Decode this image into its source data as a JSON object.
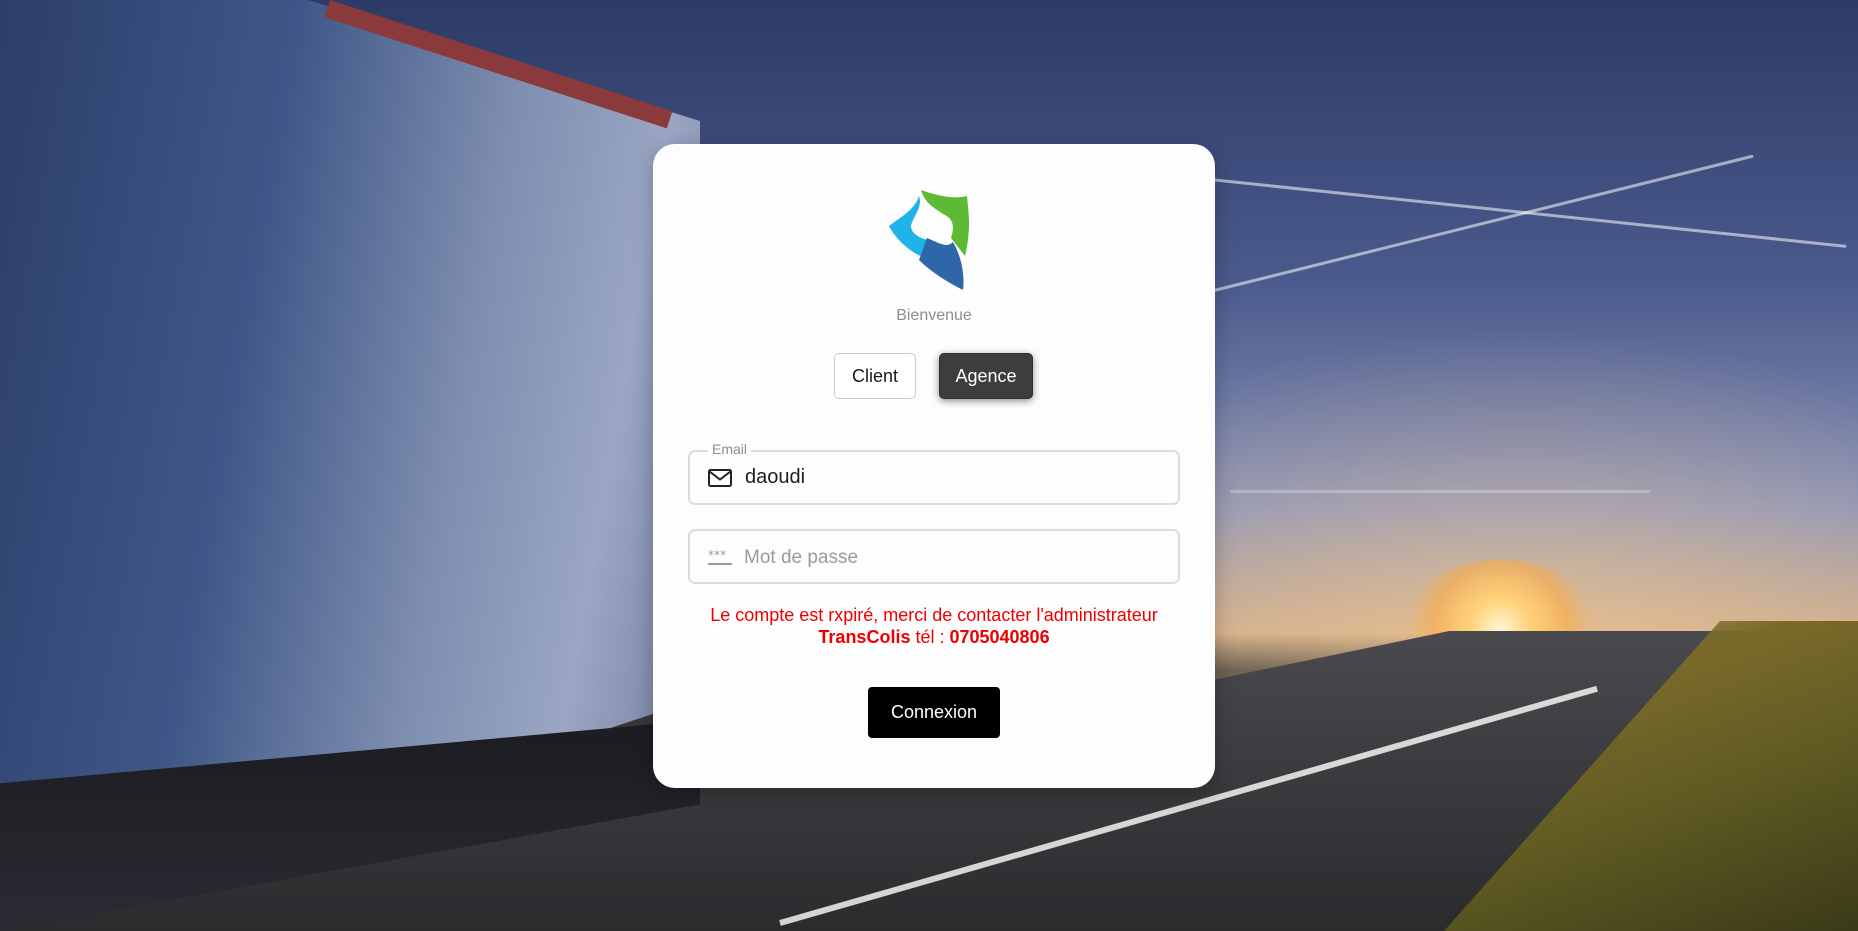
{
  "login": {
    "welcome": "Bienvenue",
    "tabs": {
      "client": "Client",
      "agence": "Agence",
      "selected": "Agence"
    },
    "email": {
      "label": "Email",
      "value": "daoudi",
      "icon": "mail-icon"
    },
    "password": {
      "placeholder": "Mot de passe",
      "icon": "password-icon"
    },
    "error": {
      "message": "Le compte est rxpiré, merci de contacter l'administrateur",
      "company": "TransColis",
      "tel_label": " tél : ",
      "phone": "0705040806"
    },
    "submit_label": "Connexion"
  },
  "colors": {
    "error": "#ee0000",
    "button_dark": "#000000",
    "tab_active": "#3d3d3d",
    "logo_blue": "#1fb3e8",
    "logo_green": "#5cba35",
    "logo_navy": "#2f66a8"
  }
}
